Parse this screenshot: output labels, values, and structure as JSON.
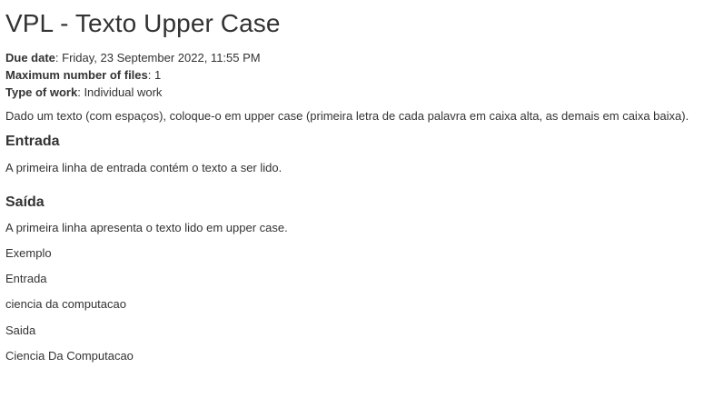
{
  "title": "VPL - Texto Upper Case",
  "meta": {
    "due_date_label": "Due date",
    "due_date_value": ": Friday, 23 September 2022, 11:55 PM",
    "max_files_label": "Maximum number of files",
    "max_files_value": ": 1",
    "work_type_label": "Type of work",
    "work_type_value": ": Individual work"
  },
  "description": "Dado um texto (com espaços), coloque-o em upper case (primeira letra de cada palavra em caixa alta, as demais em caixa baixa).",
  "sections": {
    "entrada_heading": "Entrada",
    "entrada_text": "A primeira linha de entrada contém o texto a ser lido.",
    "saida_heading": "Saída",
    "saida_text": "A primeira linha apresenta o texto lido em upper case."
  },
  "example": {
    "label": "Exemplo",
    "input_label": "Entrada",
    "input_value": "ciencia da computacao",
    "output_label": "Saida",
    "output_value": "Ciencia Da Computacao"
  }
}
